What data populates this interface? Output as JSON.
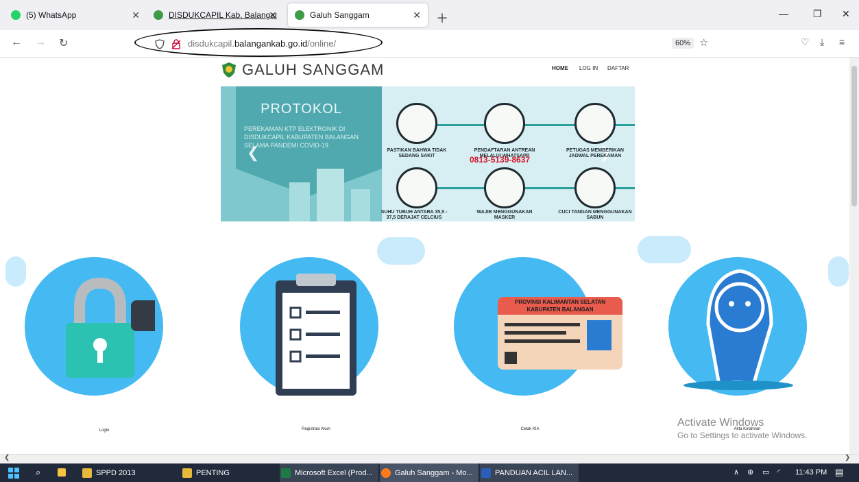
{
  "browser": {
    "tabs": [
      {
        "title": "(5) WhatsApp",
        "active": false
      },
      {
        "title": "DISDUKCAPIL Kab. Balangan",
        "active": false
      },
      {
        "title": "Galuh Sanggam",
        "active": true
      }
    ],
    "url": {
      "host_prefix": "disdukcapil.",
      "host_main": "balangankab.go.id",
      "path": "/online/"
    },
    "zoom": "60%"
  },
  "site": {
    "title": "GALUH SANGGAM",
    "menu": [
      "HOME",
      "LOG IN",
      "DAFTAR"
    ],
    "banner": {
      "title": "PROTOKOL",
      "subtitle": "PEREKAMAN KTP ELEKTRONIK DI DISDUKCAPIL KABUPATEN BALANGAN SELAMA PANDEMI COVID-19",
      "steps": [
        "PASTIKAN BAHWA TIDAK SEDANG SAKIT",
        "PENDAFTARAN ANTREAN MELALUI WHATSAPP",
        "PETUGAS MEMBERIKAN JADWAL PEREKAMAN",
        "CUCI TANGAN MENGGUNAKAN SABUN",
        "WAJIB MENGGUNAKAN MASKER",
        "SUHU TUBUH ANTARA 35,5 - 37,5 DERAJAT CELCIUS"
      ],
      "phone": "0813-5139-8637"
    },
    "features": [
      {
        "label": "Login"
      },
      {
        "label": "Registrasi Akun"
      },
      {
        "label": "Cetak KIA"
      },
      {
        "label": "Akta Kelahiran"
      }
    ],
    "ktp_card": {
      "line1": "PROVINSI KALIMANTAN SELATAN",
      "line2": "KABUPATEN BALANGAN"
    }
  },
  "watermark": {
    "line1": "Activate Windows",
    "line2": "Go to Settings to activate Windows."
  },
  "taskbar": {
    "items": [
      "SPPD 2013",
      "PENTING",
      "Microsoft Excel (Prod...",
      "Galuh Sanggam - Mo...",
      "PANDUAN ACIL LAN..."
    ],
    "clock": "11:43 PM"
  },
  "colors": {
    "accent": "#45baf2",
    "banner_teal": "#4fa9ae",
    "phone_red": "#d3162b",
    "taskbar": "#202a3a"
  }
}
